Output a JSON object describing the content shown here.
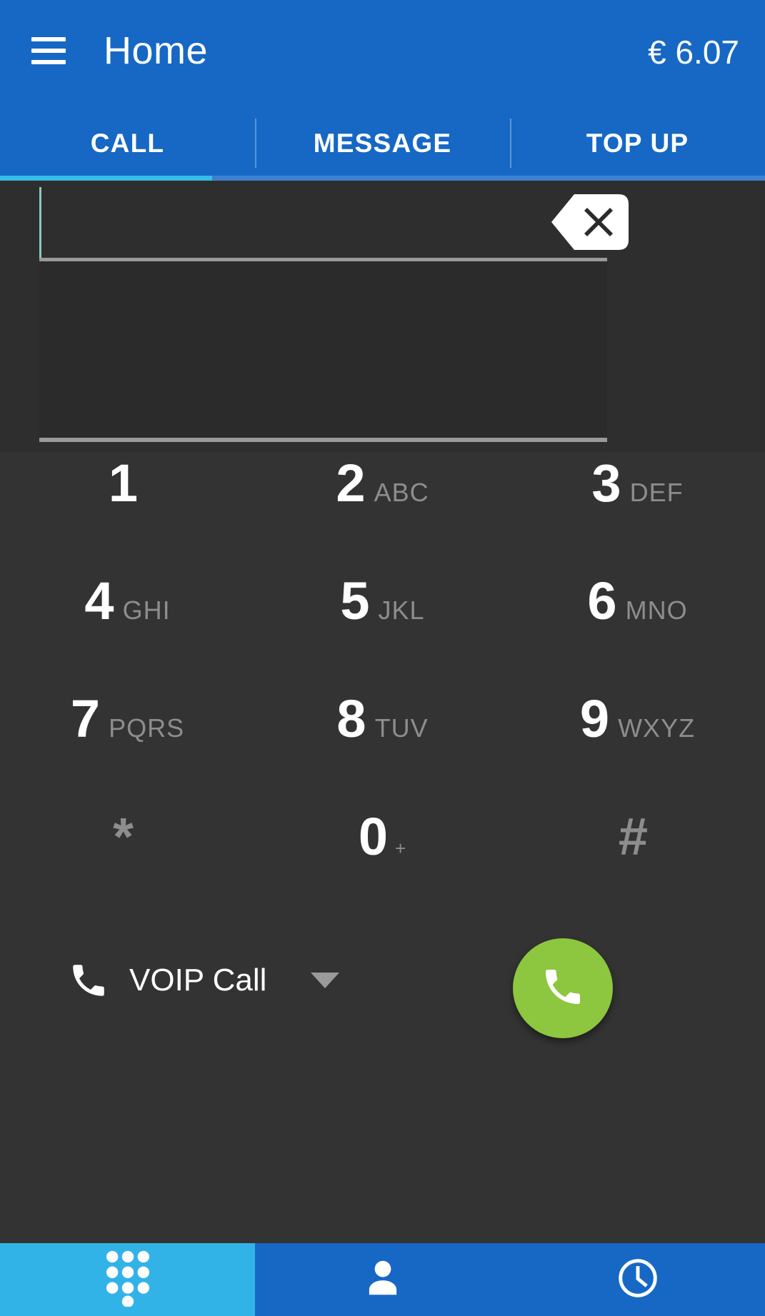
{
  "appbar": {
    "menu_icon": "hamburger-menu-icon",
    "title": "Home",
    "balance": "€ 6.07"
  },
  "tabs": {
    "items": [
      {
        "label": "CALL",
        "active": true
      },
      {
        "label": "MESSAGE",
        "active": false
      },
      {
        "label": "TOP UP",
        "active": false
      }
    ],
    "active_index": 0,
    "indicator_color": "#35bde6"
  },
  "dialer": {
    "number_value": "",
    "number_placeholder": "",
    "backspace_icon": "backspace-icon",
    "keys": [
      {
        "digit": "1",
        "letters": ""
      },
      {
        "digit": "2",
        "letters": "ABC"
      },
      {
        "digit": "3",
        "letters": "DEF"
      },
      {
        "digit": "4",
        "letters": "GHI"
      },
      {
        "digit": "5",
        "letters": "JKL"
      },
      {
        "digit": "6",
        "letters": "MNO"
      },
      {
        "digit": "7",
        "letters": "PQRS"
      },
      {
        "digit": "8",
        "letters": "TUV"
      },
      {
        "digit": "9",
        "letters": "WXYZ"
      },
      {
        "digit": "*",
        "letters": ""
      },
      {
        "digit": "0",
        "letters": "+"
      },
      {
        "digit": "#",
        "letters": ""
      }
    ]
  },
  "actions": {
    "call_type_icon": "phone-handset-icon",
    "call_type_label": "VOIP Call",
    "dropdown_icon": "caret-down-icon",
    "call_button_icon": "phone-call-icon",
    "call_button_color": "#8dc63f"
  },
  "bottom_nav": {
    "items": [
      {
        "icon": "dialpad-icon",
        "active": true
      },
      {
        "icon": "person-icon",
        "active": false
      },
      {
        "icon": "clock-history-icon",
        "active": false
      }
    ],
    "active_color": "#32b3e8",
    "inactive_color": "#1668c4"
  }
}
